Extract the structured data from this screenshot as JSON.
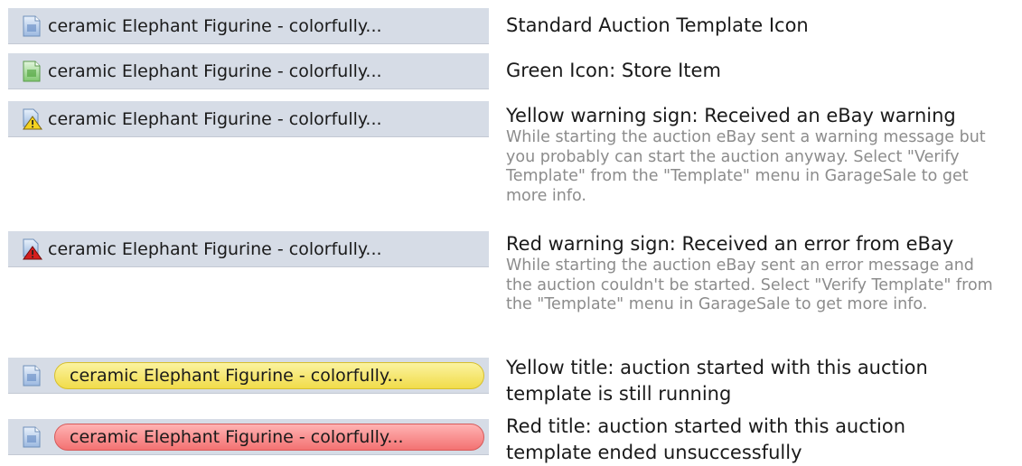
{
  "item_title": "ceramic Elephant Figurine - colorfully...",
  "rows": [
    {
      "icon": "template-doc-blue-icon",
      "heading": "Standard Auction Template Icon",
      "detail": ""
    },
    {
      "icon": "template-doc-green-icon",
      "heading": "Green Icon: Store Item",
      "detail": ""
    },
    {
      "icon": "yellow-warning-icon",
      "heading": "Yellow warning sign: Received an eBay warning",
      "detail": "While starting the auction eBay sent a warning message but you probably can start the auction anyway. Select \"Verify Template\" from the \"Template\" menu in GarageSale to get more info."
    },
    {
      "icon": "red-error-icon",
      "heading": "Red warning sign: Received an error from eBay",
      "detail": "While starting the auction eBay sent an error message and the auction couldn't be started. Select \"Verify Template\" from the \"Template\" menu in GarageSale to get more info."
    },
    {
      "icon": "template-doc-blue-icon",
      "highlight": "yellow",
      "heading": "Yellow title: auction started with this auction template is still running",
      "detail": ""
    },
    {
      "icon": "template-doc-blue-icon",
      "highlight": "red",
      "heading": "Red title: auction started with this auction template ended unsuccessfully",
      "detail": ""
    }
  ],
  "colors": {
    "bar_bg": "#d6dce6",
    "yellow_pill": "#f1dc4a",
    "red_pill": "#f37272",
    "detail_text": "#8c8c8c"
  }
}
